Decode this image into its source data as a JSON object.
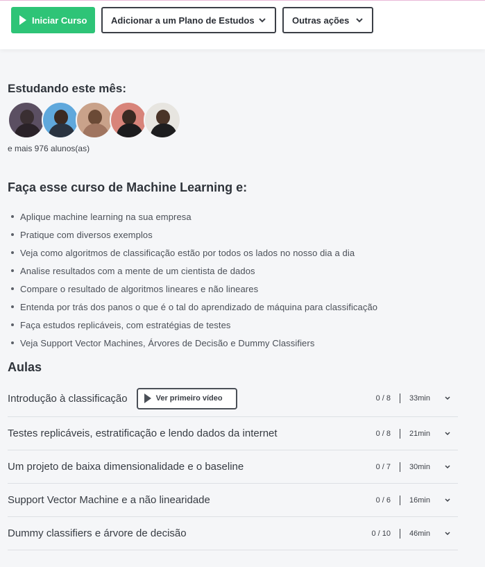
{
  "toolbar": {
    "start_label": "Iniciar Curso",
    "add_plan_label": "Adicionar a um Plano de Estudos",
    "other_actions_label": "Outras ações"
  },
  "studying": {
    "title": "Estudando este mês:",
    "more_students": "e mais 976 alunos(as)"
  },
  "course": {
    "title": "Faça esse curso de Machine Learning e:",
    "bullets": [
      "Aplique machine learning na sua empresa",
      "Pratique com diversos exemplos",
      "Veja como algoritmos de classificação estão por todos os lados no nosso dia a dia",
      "Analise resultados com a mente de um cientista de dados",
      "Compare o resultado de algoritmos lineares e não lineares",
      "Entenda por trás dos panos o que é o tal do aprendizado de máquina para classificação",
      "Faça estudos replicáveis, com estratégias de testes",
      "Veja Support Vector Machines, Árvores de Decisão e Dummy Classifiers"
    ]
  },
  "lessons": {
    "title": "Aulas",
    "watch_first_label": "Ver primeiro vídeo",
    "items": [
      {
        "title": "Introdução à classificação",
        "progress": "0 / 8",
        "duration": "33min"
      },
      {
        "title": "Testes replicáveis, estratificação e lendo dados da internet",
        "progress": "0 / 8",
        "duration": "21min"
      },
      {
        "title": "Um projeto de baixa dimensionalidade e o baseline",
        "progress": "0 / 7",
        "duration": "30min"
      },
      {
        "title": "Support Vector Machine e a não linearidade",
        "progress": "0 / 6",
        "duration": "16min"
      },
      {
        "title": "Dummy classifiers e árvore de decisão",
        "progress": "0 / 10",
        "duration": "46min"
      }
    ]
  },
  "icons": {
    "play": "play-icon",
    "chevron": "chevron-down-icon"
  },
  "colors": {
    "primary": "#2ec477",
    "background": "#f5f6f8",
    "text": "#2b2f36"
  }
}
